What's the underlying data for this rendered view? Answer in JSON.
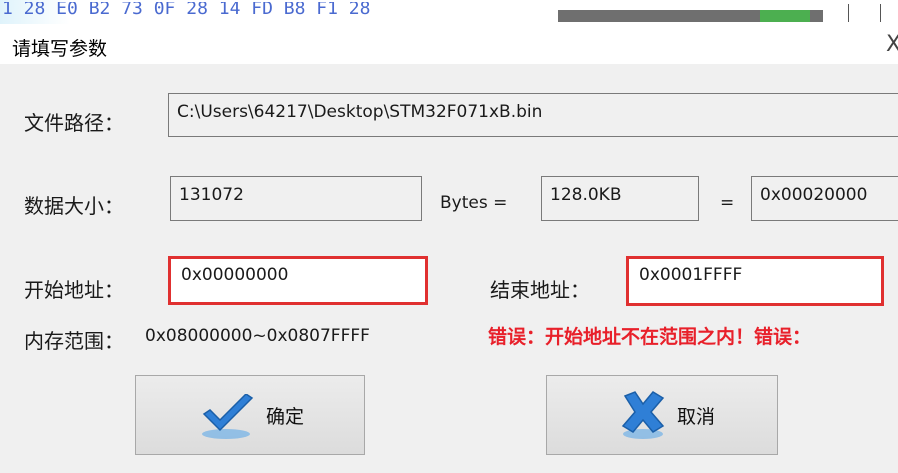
{
  "background": {
    "hex_text": "1 28 E0 B2 73 0F 28 14 FD B8 F1 28"
  },
  "dialog": {
    "title": "请填写参数",
    "close_glyph": "X"
  },
  "file_path": {
    "label": "文件路径：",
    "value": "C:\\Users\\64217\\Desktop\\STM32F071xB.bin"
  },
  "data_size": {
    "label": "数据大小：",
    "bytes_value": "131072",
    "bytes_label": "Bytes =",
    "kb_value": "128.0KB",
    "equals": "=",
    "hex_value": "0x00020000"
  },
  "start_address": {
    "label": "开始地址：",
    "value": "0x00000000"
  },
  "end_address": {
    "label": "结束地址：",
    "value": "0x0001FFFF"
  },
  "memory_range": {
    "label": "内存范围：",
    "value": "0x08000000~0x0807FFFF"
  },
  "error_message": "错误：开始地址不在范围之内！错误：",
  "buttons": {
    "ok_label": "确定",
    "cancel_label": "取消"
  },
  "colors": {
    "error": "#e8202a",
    "highlight_border": "#e03030",
    "check_icon": "#2f7fd6",
    "cancel_icon": "#2f7fd6"
  }
}
